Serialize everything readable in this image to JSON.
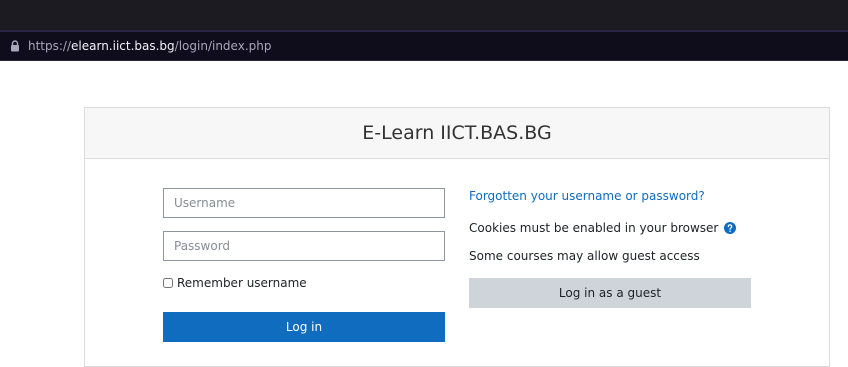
{
  "browser": {
    "url_scheme": "https://",
    "url_host": "elearn.iict.bas.bg",
    "url_path": "/login/index.php"
  },
  "site": {
    "title": "E-Learn IICT.BAS.BG"
  },
  "login_form": {
    "username_placeholder": "Username",
    "password_placeholder": "Password",
    "remember_label": "Remember username",
    "login_button": "Log in"
  },
  "info": {
    "forgot_link": "Forgotten your username or password?",
    "cookies_note": "Cookies must be enabled in your browser",
    "guest_note": "Some courses may allow guest access",
    "guest_button": "Log in as a guest"
  },
  "colors": {
    "primary": "#0f6cbf",
    "secondary": "#ced4da",
    "browser_bg": "#1c1b22"
  }
}
